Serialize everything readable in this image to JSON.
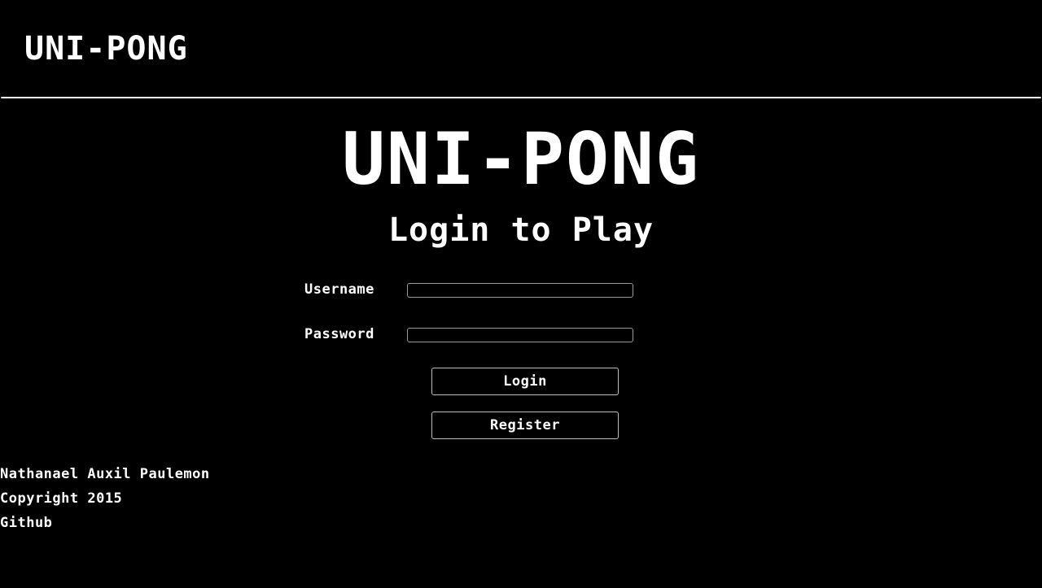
{
  "header": {
    "title": "UNI-PONG"
  },
  "main": {
    "title": "UNI-PONG",
    "subtitle": "Login to Play"
  },
  "form": {
    "username_label": "Username",
    "username_value": "",
    "password_label": "Password",
    "password_value": "",
    "login_label": "Login",
    "register_label": "Register"
  },
  "footer": {
    "author": "Nathanael Auxil Paulemon",
    "copyright": "Copyright 2015",
    "github": "Github"
  },
  "colors": {
    "background": "#000000",
    "text": "#ffffff",
    "input_border": "#9a9a9a"
  }
}
